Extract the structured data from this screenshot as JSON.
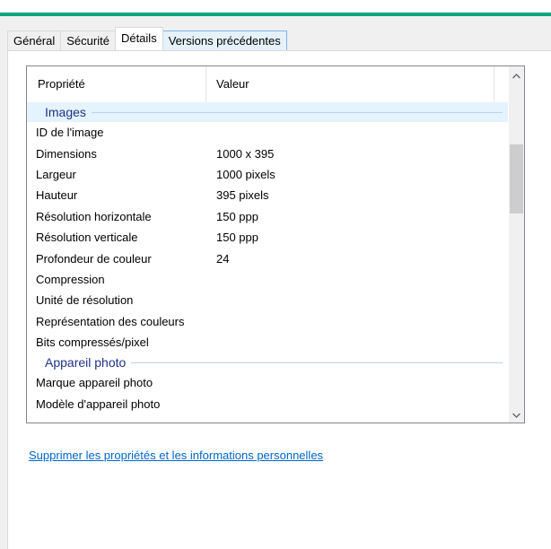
{
  "tabs": [
    {
      "label": "Général"
    },
    {
      "label": "Sécurité"
    },
    {
      "label": "Détails"
    },
    {
      "label": "Versions précédentes"
    }
  ],
  "columns": {
    "property": "Propriété",
    "value": "Valeur"
  },
  "groups": {
    "images": {
      "title": "Images",
      "rows": [
        {
          "property": "ID de l'image",
          "value": ""
        },
        {
          "property": "Dimensions",
          "value": "1000 x 395"
        },
        {
          "property": "Largeur",
          "value": "1000 pixels"
        },
        {
          "property": "Hauteur",
          "value": "395 pixels"
        },
        {
          "property": "Résolution horizontale",
          "value": "150 ppp"
        },
        {
          "property": "Résolution verticale",
          "value": "150 ppp"
        },
        {
          "property": "Profondeur de couleur",
          "value": "24"
        },
        {
          "property": "Compression",
          "value": ""
        },
        {
          "property": "Unité de résolution",
          "value": ""
        },
        {
          "property": "Représentation des couleurs",
          "value": ""
        },
        {
          "property": "Bits compressés/pixel",
          "value": ""
        }
      ]
    },
    "camera": {
      "title": "Appareil photo",
      "rows": [
        {
          "property": "Marque appareil photo",
          "value": ""
        },
        {
          "property": "Modèle d'appareil photo",
          "value": ""
        }
      ]
    }
  },
  "icons": {
    "scroll_up": "chevron-up-icon",
    "scroll_down": "chevron-down-icon"
  },
  "privacy_link": "Supprimer les propriétés et les informations personnelles",
  "colors": {
    "accent": "#00a77d",
    "link": "#0066cc",
    "group_title": "#1e3287"
  }
}
